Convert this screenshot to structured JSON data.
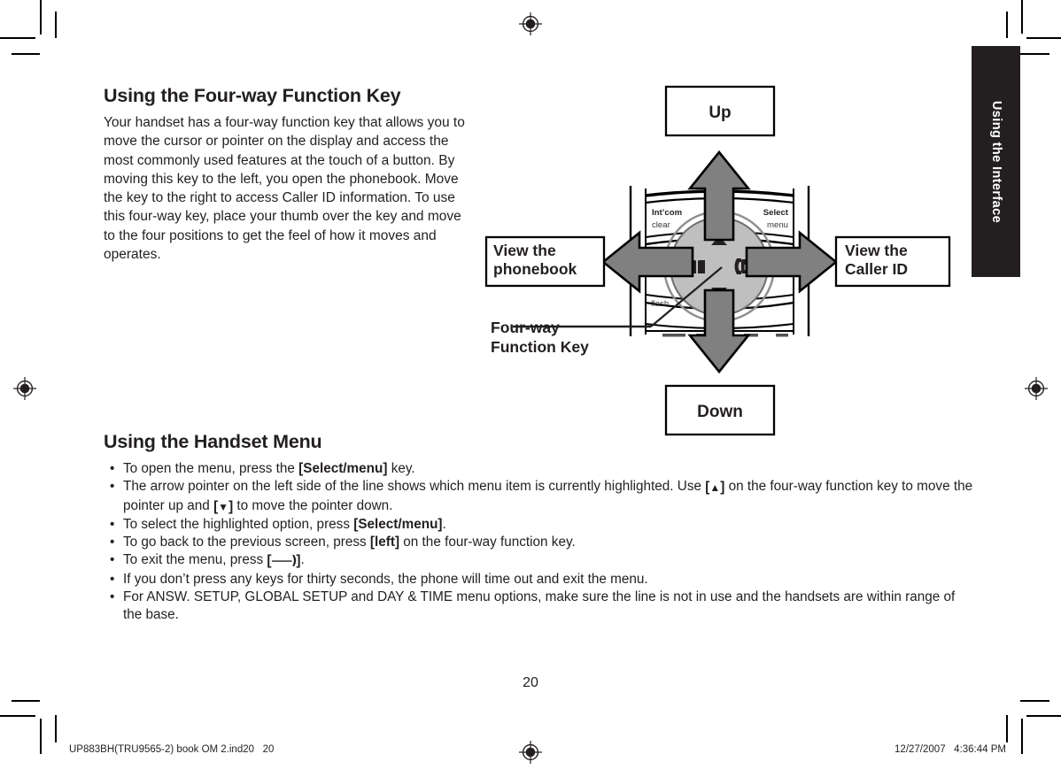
{
  "chapter_tab": {
    "label": "Using the Interface"
  },
  "page": {
    "number": "20"
  },
  "sections": [
    {
      "id": "four-way",
      "title": "Using the Four-way Function Key",
      "body": "Your handset has a four-way function key that allows you to move the cursor or pointer on the display and access the most commonly used features at the touch of a button. By moving this key to the left, you open the phonebook. Move the key to the right to access Caller ID information. To use this four-way key, place your thumb over the key and move to the four positions to get the feel of how it moves and operates."
    },
    {
      "id": "handset-menu",
      "title": "Using the Handset Menu"
    }
  ],
  "bullets": [
    {
      "pre": "To open the menu, press the ",
      "bold": "[Select/menu]",
      "post": " key."
    },
    {
      "pre": "The arrow pointer on the left side of the line shows which menu item is currently highlighted. Use ",
      "glyph": "up",
      "post": " on the four-way function key to move the pointer up and ",
      "glyph2": "down",
      "post2": " to move the pointer down."
    },
    {
      "pre": "To select the highlighted option, press ",
      "bold": "[Select/menu]",
      "post": "."
    },
    {
      "pre": "To go back to the previous screen, press ",
      "bold": "[left]",
      "post": " on the four-way function key."
    },
    {
      "pre": "To exit the menu, press ",
      "glyph": "power",
      "post": "."
    },
    {
      "pre": "If you don’t press any keys for thirty seconds, the phone will time out and exit the menu.",
      "bold": "",
      "post": ""
    },
    {
      "pre": "For ANSW. SETUP, GLOBAL SETUP and DAY & TIME menu options, make sure the line is not in use and the handsets are within range of the base.",
      "bold": "",
      "post": ""
    }
  ],
  "bullet_marker": "•",
  "diagram": {
    "callouts": {
      "up": "Up",
      "down": "Down",
      "left_line1": "View the",
      "left_line2": "phonebook",
      "right_line1": "View the",
      "right_line2": "Caller ID",
      "leader_line1": "Four-way",
      "leader_line2": "Function Key"
    },
    "keypad_labels": {
      "intcom": "Int’com",
      "clear": "clear",
      "select": "Select",
      "menu": "menu",
      "flash": "flash"
    },
    "key_icons": {
      "phonebook": "book-icon",
      "callerid": "caller-id-icon",
      "up": "triangle-up-icon",
      "down": "triangle-down-icon"
    },
    "colors": {
      "arrow_fill": "#808080",
      "arrow_stroke": "#000000",
      "key_fill": "#bfbfbf",
      "outline": "#000000"
    }
  },
  "footer": {
    "left": "UP883BH(TRU9565-2) book OM 2.ind20   20",
    "right": "12/27/2007   4:36:44 PM"
  }
}
